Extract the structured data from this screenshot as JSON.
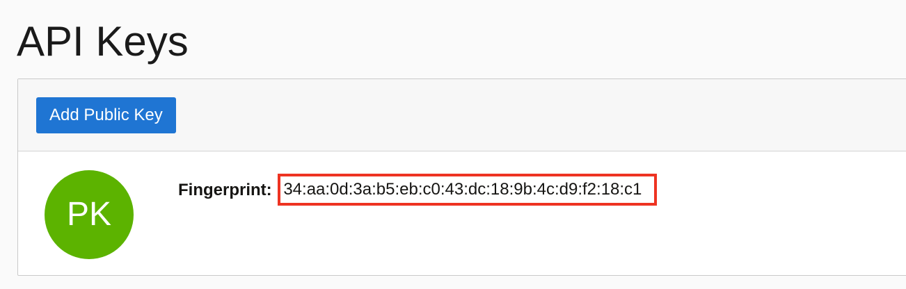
{
  "page": {
    "title": "API Keys"
  },
  "toolbar": {
    "add_label": "Add Public Key"
  },
  "keys": [
    {
      "avatar_initials": "PK",
      "fingerprint_label": "Fingerprint:",
      "fingerprint_value": "34:aa:0d:3a:b5:eb:c0:43:dc:18:9b:4c:d9:f2:18:c1"
    }
  ],
  "colors": {
    "primary_button": "#1f75d3",
    "avatar": "#5cb300",
    "highlight": "#ee3322"
  }
}
